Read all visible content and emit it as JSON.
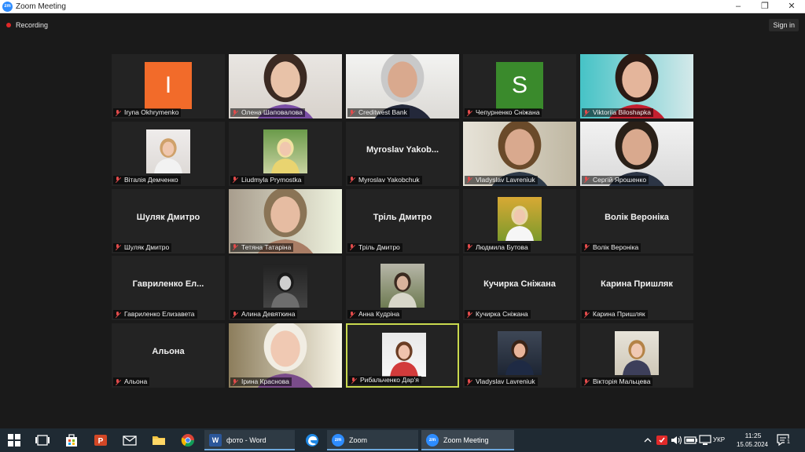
{
  "window": {
    "title": "Zoom Meeting",
    "app_icon": "zm"
  },
  "toolbar": {
    "recording_label": "Recording",
    "signin_label": "Sign in"
  },
  "participants": [
    {
      "name": "Iryna Okhrymenko",
      "type": "avatar",
      "initial": "I",
      "color": "#f26b2a"
    },
    {
      "name": "Олена Шаповалова",
      "type": "video"
    },
    {
      "name": "Creditwest Bank",
      "type": "video"
    },
    {
      "name": "Чепурненко Сніжана",
      "type": "avatar",
      "initial": "S",
      "color": "#3a8a2c"
    },
    {
      "name": "Viktoriia Biloshapka",
      "type": "video"
    },
    {
      "name": "Віталія Демченко",
      "type": "photo"
    },
    {
      "name": "Liudmyla Prymostka",
      "type": "photo"
    },
    {
      "name": "Myroslav Yakobchuk",
      "type": "name",
      "display": "Myroslav  Yakob..."
    },
    {
      "name": "Vladyslav Lavreniuk",
      "type": "video"
    },
    {
      "name": "Сергій Ярошенко",
      "type": "video"
    },
    {
      "name": "Шуляк Дмитро",
      "type": "name",
      "display": "Шуляк Дмитро"
    },
    {
      "name": "Тетяна Татаріна",
      "type": "video"
    },
    {
      "name": "Тріль Дмитро",
      "type": "name",
      "display": "Тріль Дмитро"
    },
    {
      "name": "Людмила Бутова",
      "type": "photo"
    },
    {
      "name": "Волік Вероніка",
      "type": "name",
      "display": "Волік Вероніка"
    },
    {
      "name": "Гавриленко Елизавета",
      "type": "name",
      "display": "Гавриленко  Ел..."
    },
    {
      "name": "Алина Девяткина",
      "type": "photo"
    },
    {
      "name": "Анна Кудріна",
      "type": "photo"
    },
    {
      "name": "Кучирка Сніжана",
      "type": "name",
      "display": "Кучирка Сніжана"
    },
    {
      "name": "Карина Пришляк",
      "type": "name",
      "display": "Карина Пришляк"
    },
    {
      "name": "Альона",
      "type": "name",
      "display": "Альона"
    },
    {
      "name": "Ірина Краснова",
      "type": "video"
    },
    {
      "name": "Рибальченко Дар'я",
      "type": "photo",
      "active": true
    },
    {
      "name": "Vladyslav Lavreniuk",
      "type": "photo"
    },
    {
      "name": "Вікторія Мальцева",
      "type": "photo"
    }
  ],
  "taskbar": {
    "apps": [
      {
        "label": "фото - Word",
        "icon": "word-icon"
      },
      {
        "label": "Zoom",
        "icon": "zoom-icon"
      },
      {
        "label": "Zoom Meeting",
        "icon": "zoom-icon"
      }
    ],
    "language": "УКР",
    "time": "11:25",
    "date": "15.05.2024",
    "notification_count": "1"
  }
}
